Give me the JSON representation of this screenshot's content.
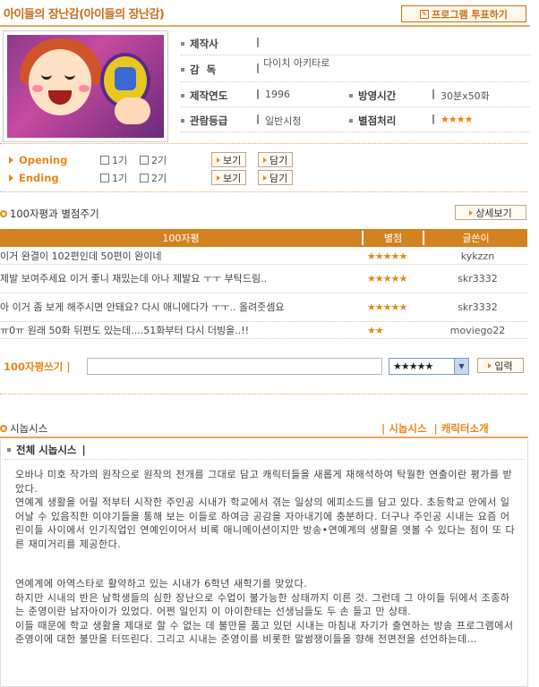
{
  "page": {
    "title": "아이들의 장난감(아이들의 장난감)",
    "vote_button": "프로그램 투표하기"
  },
  "info": {
    "producer_label": "제작사",
    "producer_value": "",
    "director_label": "감  독",
    "director_value": "다이치 아키타로",
    "year_label": "제작연도",
    "year_value": "1996",
    "runtime_label": "방영시간",
    "runtime_value": "30분x50화",
    "rating_label": "관람등급",
    "rating_value": "일반시청",
    "score_label": "별점처리",
    "score_stars": "★★★★"
  },
  "themes": {
    "opening_label": "Opening",
    "ending_label": "Ending",
    "opt1": "1기",
    "opt2": "2기",
    "view_button": "보기",
    "save_button": "담기"
  },
  "reviews": {
    "section_title": "100자평과 별점주기",
    "detail_button": "상세보기",
    "col_review": "100자평",
    "col_stars": "별점",
    "col_author": "글쓴이",
    "rows": [
      {
        "text": "이거 완결이 102편인데 50편이 완이네",
        "stars": "★★★★★",
        "author": "kykzzn"
      },
      {
        "text": "제발 보여주세요 이거 좋니 재밌는데 아나 제발요 ㅜㅜ 부탁드림..",
        "stars": "★★★★★",
        "author": "skr3332"
      },
      {
        "text": "아 이거 좀 보게 해주시면 안돼요? 다시 애니에다가 ㅜㅜ.. 올려줏셈요",
        "stars": "★★★★★",
        "author": "skr3332"
      },
      {
        "text": "ㅠ0ㅠ 원래 50화 뒤편도 있는데....51화부터 다시 더빙을..!!",
        "stars": "★★",
        "author": "moviego22"
      }
    ]
  },
  "write": {
    "label": "100자평쓰기",
    "input_value": "",
    "select_value": "★★★★★",
    "submit_button": "입력"
  },
  "synopsis": {
    "section_title": "시놉시스",
    "link_synopsis": "시놉시스",
    "link_character": "캐릭터소개",
    "sub_title": "전체 시놉시스",
    "para1": "오바나 미호 작가의 원작으로 원작의 전개를 그대로 담고 캐릭터들을 새롭게 재해석하여 탁월한 연출이란 평가를 받았다.\n연예계 생활을 어릴 적부터 시작한 주인공 시내가 학교에서 겪는 일상의 에피소드를 담고 있다. 초등학교 안에서 일어날 수 있음직한 이야기들을 통해 보는 이들로 하여금 공감을 자아내기에 충분하다. 더구나 주인공 시내는 요즘 어린이들 사이에서 인기직업인 연예인이어서 비록 애니메이션이지만 방송•연예계의 생활을 엿볼 수 있다는 점이 또 다른 재미거리를 제공한다.",
    "para2": "연예계에 아역스타로 활약하고 있는 시내가 6학년 새학기를 맞았다.\n하지만 시내의 반은 남학생들의 심한 장난으로 수업이 불가능한 상태까지 이른 것. 그런데 그 아이들 뒤에서 조종하는 준영이란 남자아이가 있었다. 어쩐 일인지 이 아이한테는 선생님들도 두 손 들고 만 상태.\n이들 때문에 학교 생활을 제대로 할 수 없는 데 불만을 품고 있던 시내는 마침내 자기가 출연하는 방송 프로그램에서 준영이에 대한 불만을 터뜨린다. 그리고 시내는 준영이를 비롯한 말썽쟁이들을 향해 전면전을 선언하는데…"
  }
}
